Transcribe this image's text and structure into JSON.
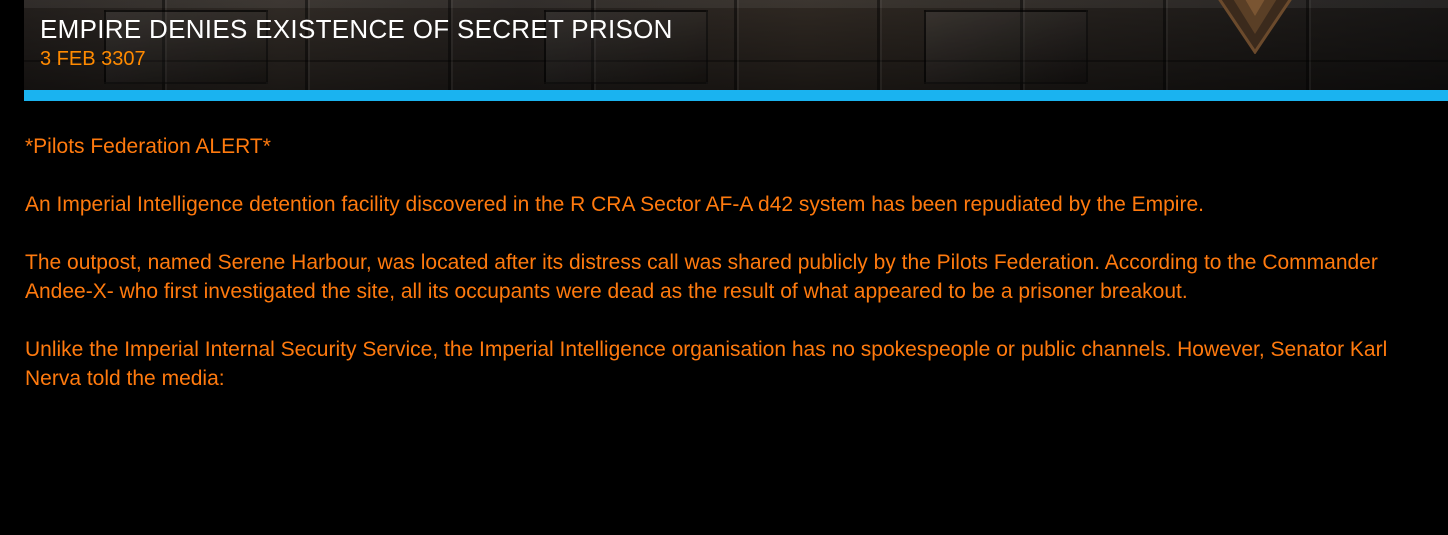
{
  "article": {
    "title": "EMPIRE DENIES EXISTENCE OF SECRET PRISON",
    "date": "3 FEB 3307",
    "paragraphs": [
      "*Pilots Federation ALERT*",
      "An Imperial Intelligence detention facility discovered in the R CRA Sector AF-A d42 system has been repudiated by the Empire.",
      "The outpost, named Serene Harbour, was located after its distress call was shared publicly by the Pilots Federation. According to the Commander Andee-X- who first investigated the site, all its occupants were dead as the result of what appeared to be a prisoner breakout.",
      "Unlike the Imperial Internal Security Service, the Imperial Intelligence organisation has no spokespeople or public channels. However, Senator Karl Nerva told the media:"
    ]
  },
  "theme": {
    "background": "#000000",
    "title_color": "#ffffff",
    "date_color": "#ff8a00",
    "body_color": "#ff7a0e",
    "accent_bar": "#1ab3f0"
  },
  "icons": {
    "header_emblem": "imperial-chevron-emblem-icon"
  }
}
